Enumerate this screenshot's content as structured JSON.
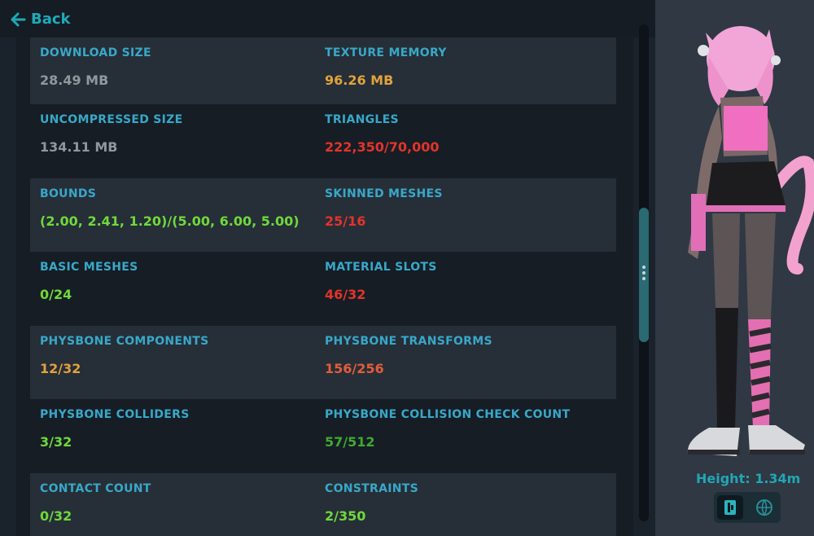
{
  "nav": {
    "back_label": "Back",
    "back_icon": "arrow-left-icon"
  },
  "stats": [
    {
      "left": {
        "label": "DOWNLOAD SIZE",
        "value": "28.49 MB",
        "color": "#8f989c"
      },
      "right": {
        "label": "TEXTURE MEMORY",
        "value": "96.26 MB",
        "color": "#e0a33a"
      }
    },
    {
      "left": {
        "label": "UNCOMPRESSED SIZE",
        "value": "134.11 MB",
        "color": "#8f989c"
      },
      "right": {
        "label": "TRIANGLES",
        "value": "222,350/70,000",
        "color": "#e2342a"
      }
    },
    {
      "left": {
        "label": "BOUNDS",
        "value": "(2.00, 2.41, 1.20)/(5.00, 6.00, 5.00)",
        "color": "#6fd93a"
      },
      "right": {
        "label": "SKINNED MESHES",
        "value": "25/16",
        "color": "#e2342a"
      }
    },
    {
      "left": {
        "label": "BASIC MESHES",
        "value": "0/24",
        "color": "#6fd93a"
      },
      "right": {
        "label": "MATERIAL SLOTS",
        "value": "46/32",
        "color": "#e2342a"
      }
    },
    {
      "left": {
        "label": "PHYSBONE COMPONENTS",
        "value": "12/32",
        "color": "#e0a33a"
      },
      "right": {
        "label": "PHYSBONE TRANSFORMS",
        "value": "156/256",
        "color": "#e05e3a"
      }
    },
    {
      "left": {
        "label": "PHYSBONE COLLIDERS",
        "value": "3/32",
        "color": "#6fd93a"
      },
      "right": {
        "label": "PHYSBONE COLLISION CHECK COUNT",
        "value": "57/512",
        "color": "#3faa2f"
      }
    },
    {
      "left": {
        "label": "CONTACT COUNT",
        "value": "0/32",
        "color": "#6fd93a"
      },
      "right": {
        "label": "CONSTRAINTS",
        "value": "2/350",
        "color": "#6fd93a"
      }
    }
  ],
  "preview": {
    "height_label": "Height: 1.34m",
    "toggle_icons": [
      "info-icon",
      "globe-icon"
    ]
  }
}
